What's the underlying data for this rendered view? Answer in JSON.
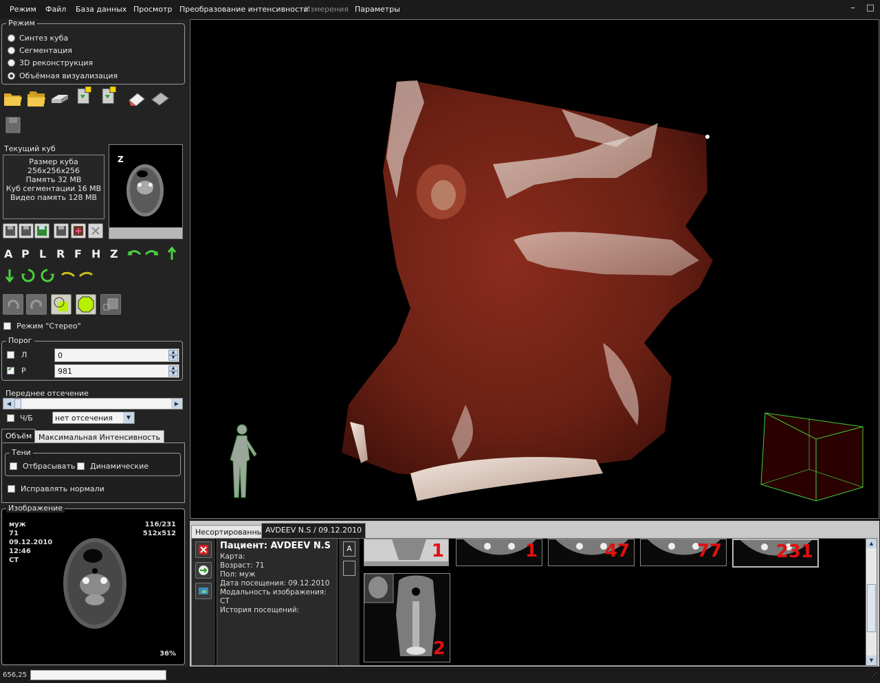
{
  "menu": [
    "Режим",
    "Файл",
    "База данных",
    "Просмотр",
    "Преобразование интенсивности",
    "Измерения",
    "Параметры"
  ],
  "window_controls": {
    "minimize": "–",
    "maximize": "□"
  },
  "mode_group": {
    "title": "Режим",
    "options": [
      "Синтез куба",
      "Сегментация",
      "3D реконструкция",
      "Объёмная визуализация"
    ],
    "selected": 3
  },
  "current_cube": {
    "title": "Текущий куб",
    "lines": [
      "Размер куба 256x256x256",
      "Память 32 MB",
      "Куб сегментации 16 MB",
      "Видео память 128 MB"
    ],
    "thumb_label": "Z"
  },
  "direction_letters": [
    "A",
    "P",
    "L",
    "R",
    "F",
    "H",
    "Z"
  ],
  "stereo": {
    "label": "Режим \"Стерео\"",
    "checked": false
  },
  "threshold": {
    "title": "Порог",
    "rows": [
      {
        "label": "Л",
        "checked": false,
        "value": "0"
      },
      {
        "label": "Р",
        "checked": true,
        "value": "981"
      }
    ]
  },
  "front_clip": {
    "title": "Переднее отсечение",
    "bw_label": "Ч/Б",
    "bw_checked": false,
    "select_value": "нет отсечения"
  },
  "render_tabs": [
    "Объём",
    "Максимальная Интенсивность"
  ],
  "shadows": {
    "title": "Тени",
    "cast": "Отбрасывать",
    "dynamic": "Динамические",
    "fix_normals": "Исправлять нормали"
  },
  "image_panel": {
    "title": "Изображение",
    "sex": "муж",
    "age": "71",
    "date": "09.12.2010",
    "time": "12:46",
    "modality": "CT",
    "slice": "116/231",
    "matrix": "512x512",
    "zoom": "36%"
  },
  "bottom_tabs": [
    "Несортированные",
    "AVDEEV N.S / 09.12.2010"
  ],
  "patient": {
    "title": "Пациент: AVDEEV N.S",
    "lines": [
      "Карта:",
      "Возраст: 71",
      "Пол: муж",
      "Дата посещения: 09.12.2010",
      "Модальность изображения: CT",
      "История посещений:"
    ]
  },
  "view_button": "A",
  "series_numbers": [
    "1",
    "1",
    "47",
    "77",
    "231",
    "2"
  ],
  "status": {
    "coords": "656,25"
  },
  "colors": {
    "accent_green": "#4bcf3f",
    "series_number_red": "#e01010",
    "tissue": "#7a2418",
    "background": "#1b1b1b"
  }
}
